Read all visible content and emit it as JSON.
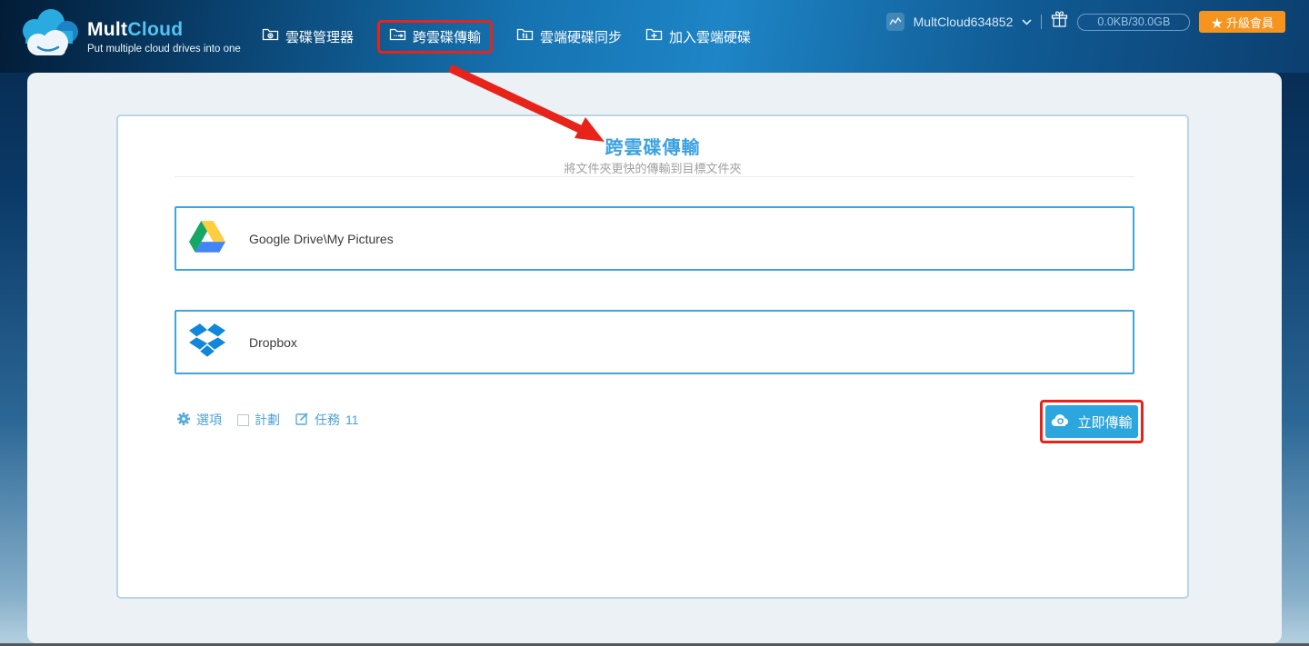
{
  "brand": {
    "name_part1": "Mult",
    "name_part2": "Cloud",
    "tagline": "Put multiple cloud drives into one",
    "logo_icon": "multcloud-cloud-logo"
  },
  "nav": {
    "items": [
      {
        "label": "雲碟管理器",
        "icon": "folder-gear-icon",
        "highlighted": false
      },
      {
        "label": "跨雲碟傳輸",
        "icon": "folder-transfer-icon",
        "highlighted": true
      },
      {
        "label": "雲端硬碟同步",
        "icon": "folder-sync-icon",
        "highlighted": false
      },
      {
        "label": "加入雲端硬碟",
        "icon": "folder-add-icon",
        "highlighted": false
      }
    ]
  },
  "account": {
    "avatar_icon": "activity-avatar-icon",
    "username": "MultCloud634852",
    "chevron_icon": "chevron-down-icon",
    "gift_icon": "gift-icon",
    "storage": "0.0KB/30.0GB",
    "upgrade_label": "★ 升級會員"
  },
  "panel": {
    "title": "跨雲碟傳輸",
    "subtitle": "將文件夾更快的傳輸到目標文件夾",
    "source": {
      "provider": "Google Drive",
      "path_label": "Google Drive\\My Pictures",
      "icon": "google-drive-icon"
    },
    "destination": {
      "provider": "Dropbox",
      "path_label": "Dropbox",
      "icon": "dropbox-icon"
    },
    "options_label": "選項",
    "schedule_label": "計劃",
    "tasks_label": "任務",
    "tasks_count": "11",
    "transfer_button_label": "立即傳輸",
    "transfer_button_icon": "cloud-sync-icon"
  },
  "annotations": {
    "highlighted_nav_item": "跨雲碟傳輸",
    "highlighted_button": "立即傳輸",
    "arrow": "red arrow from nav item 跨雲碟傳輸 to panel title"
  },
  "colors": {
    "accent_blue": "#2ca6df",
    "title_blue": "#3ba1e1",
    "box_border_blue": "#3fa5db",
    "highlight_red": "#e8231a",
    "upgrade_orange": "#f7941d",
    "header_navy": "#0b3a68",
    "panel_bg": "#ecf1f5"
  }
}
